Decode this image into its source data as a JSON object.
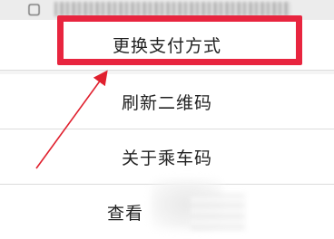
{
  "menu": {
    "items": [
      {
        "label": "更换支付方式"
      },
      {
        "label": "刷新二维码"
      },
      {
        "label": "关于乘车码"
      },
      {
        "label": "查看"
      }
    ]
  },
  "annotation": {
    "highlight_color": "#e8253f",
    "arrow_color": "#e0202e"
  }
}
